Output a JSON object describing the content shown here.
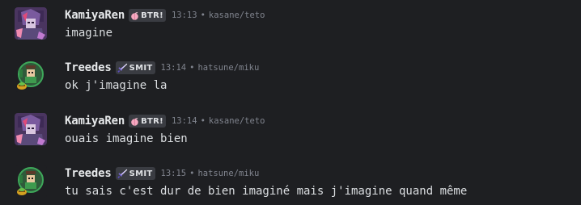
{
  "messages": [
    {
      "username": "KamiyaRen",
      "badge_icon": "peach-icon",
      "badge_text": "BTR!",
      "time": "13:13",
      "separator": "•",
      "source": "kasane/teto",
      "text": "imagine"
    },
    {
      "username": "Treedes",
      "badge_icon": "sword-icon",
      "badge_text": "SMIT",
      "time": "13:14",
      "separator": "•",
      "source": "hatsune/miku",
      "text": "ok j'imagine la"
    },
    {
      "username": "KamiyaRen",
      "badge_icon": "peach-icon",
      "badge_text": "BTR!",
      "time": "13:14",
      "separator": "•",
      "source": "kasane/teto",
      "text": "ouais imagine bien"
    },
    {
      "username": "Treedes",
      "badge_icon": "sword-icon",
      "badge_text": "SMIT",
      "time": "13:15",
      "separator": "•",
      "source": "hatsune/miku",
      "text": "tu sais c'est dur de bien imaginé mais j'imagine quand même"
    }
  ],
  "colors": {
    "background": "#1e1f22",
    "username": "#e6e8ea",
    "badge_bg": "#3a3c42",
    "meta": "#80848e",
    "text": "#dbdee1"
  }
}
